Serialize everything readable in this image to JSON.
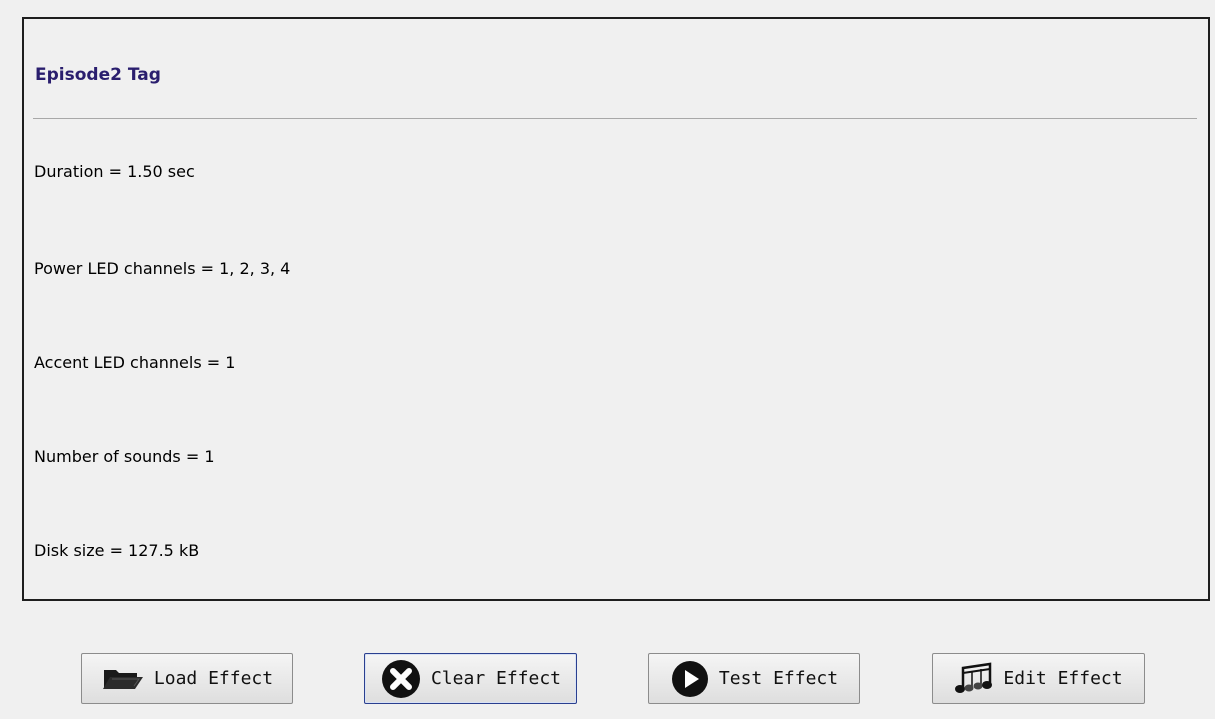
{
  "panel": {
    "title": "Episode2 Tag",
    "lines": [
      "Duration = 1.50 sec",
      "Power LED channels =  1, 2, 3, 4",
      "Accent LED channels =  1",
      "Number of sounds = 1",
      "Disk size = 127.5 kB"
    ]
  },
  "buttons": {
    "load": {
      "label": "Load Effect",
      "icon": "folder-open-icon"
    },
    "clear": {
      "label": "Clear Effect",
      "icon": "close-circle-icon"
    },
    "test": {
      "label": "Test Effect",
      "icon": "play-circle-icon"
    },
    "edit": {
      "label": "Edit Effect",
      "icon": "music-notes-icon"
    }
  },
  "colors": {
    "title": "#2a1e6e",
    "focus_border": "#2a3f8f",
    "panel_border": "#1e1e1e"
  }
}
